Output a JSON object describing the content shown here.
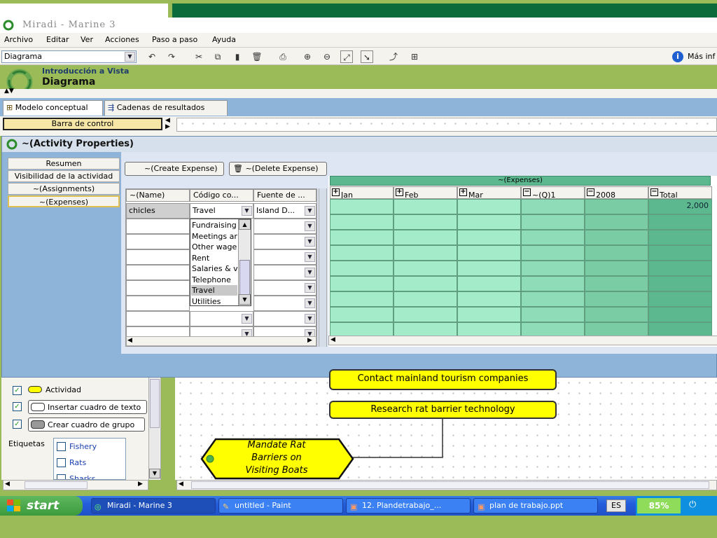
{
  "window": {
    "title": "Miradi - Marine 3"
  },
  "menu": [
    "Archivo",
    "Editar",
    "Ver",
    "Acciones",
    "Paso a paso",
    "Ayuda"
  ],
  "toolbar": {
    "view_select": "Diagrama",
    "info_button": "Más inf"
  },
  "banner": {
    "subtitle": "Introducción a Vista",
    "title": "Diagrama"
  },
  "tabs": [
    {
      "label": "Modelo conceptual",
      "icon": "conceptual-model-icon"
    },
    {
      "label": "Cadenas de resultados",
      "icon": "results-chain-icon"
    }
  ],
  "control_bar": {
    "label": "Barra de control"
  },
  "dialog": {
    "title": "~(Activity Properties)",
    "nav": [
      "Resumen",
      "Visibilidad de la actividad",
      "~(Assignments)",
      "~(Expenses)"
    ],
    "buttons": {
      "create": "~(Create Expense)",
      "delete": "~(Delete Expense)"
    },
    "table": {
      "headers": [
        "~(Name)",
        "Código co...",
        "Fuente de ..."
      ],
      "first_row": {
        "name": "chicles",
        "code": "Travel",
        "source": "Island D..."
      },
      "code_options": [
        "Fundraising",
        "Meetings ar",
        "Other wage",
        "Rent",
        "Salaries & v",
        "Telephone",
        "Travel",
        "Utilities"
      ],
      "selected_option": "Travel"
    },
    "expenses": {
      "group_header": "~(Expenses)",
      "columns": [
        "Jan",
        "Feb",
        "Mar",
        "~(Q)1",
        "2008",
        "Total"
      ],
      "total_value": "2,000"
    }
  },
  "legend": {
    "items": [
      {
        "label": "Actividad",
        "checked": true
      },
      {
        "label": "Insertar cuadro de texto",
        "checked": true
      },
      {
        "label": "Crear cuadro de grupo",
        "checked": true
      }
    ],
    "tags_label": "Etiquetas",
    "tags": [
      "Fishery",
      "Rats",
      "Sharks"
    ]
  },
  "diagram": {
    "node_partial": "Contact mainland tourism companies",
    "node_research": "Research rat barrier technology",
    "node_strategy": [
      "Mandate Rat",
      "Barriers on",
      "Visiting Boats"
    ]
  },
  "taskbar": {
    "start": "start",
    "tasks": [
      "Miradi - Marine 3",
      "untitled - Paint",
      "12. Plandetrabajo_...",
      "plan de trabajo.ppt"
    ],
    "lang": "ES",
    "battery": "85%"
  },
  "colors": {
    "accent_green": "#9bbb59",
    "dark_green": "#0b6b3a",
    "dialog_blue": "#8fb4d9",
    "expense_light": "#a3ebc9",
    "expense_dark": "#5cb88e",
    "node_yellow": "#ffff00"
  }
}
